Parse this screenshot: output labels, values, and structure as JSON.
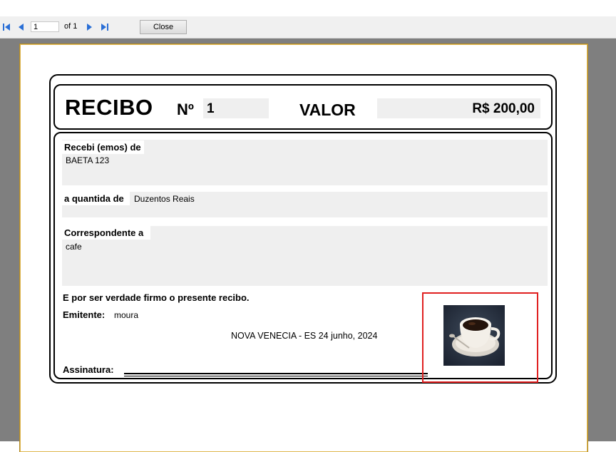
{
  "toolbar": {
    "page_value": "1",
    "of_label": "of 1",
    "close_label": "Close",
    "nav_icons": [
      "first-page-icon",
      "prev-page-icon",
      "next-page-icon",
      "last-page-icon"
    ]
  },
  "receipt": {
    "title": "RECIBO",
    "number_label": "Nº",
    "number_value": "1",
    "valor_label": "VALOR",
    "valor_value": "R$ 200,00",
    "received_from_label": "Recebi (emos) de",
    "received_from_value": "BAETA 123",
    "amount_label": "a quantida de",
    "amount_value": "Duzentos Reais",
    "corresponding_label": "Correspondente a",
    "corresponding_value": "cafe",
    "declaration": "E por ser verdade firmo o presente recibo.",
    "issuer_label": "Emitente:",
    "issuer_value": "moura",
    "place_date": "NOVA VENECIA - ES  24 junho, 2024",
    "signature_label": "Assinatura:",
    "image_icon": "coffee-cup-image"
  },
  "colors": {
    "field_bg": "#efefef",
    "viewer_bg": "#7f7f7f",
    "highlight_frame": "#e02020",
    "page_border": "#e0b850"
  }
}
